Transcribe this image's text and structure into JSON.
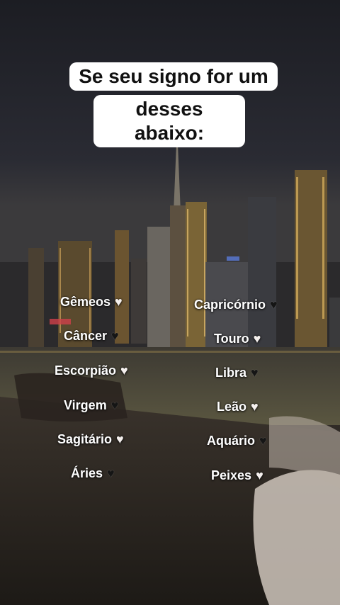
{
  "caption": {
    "line1": "Se seu signo for um",
    "line2": "desses abaixo:"
  },
  "left_signs": [
    {
      "name": "Gêmeos",
      "heart": "white-heart-icon",
      "glyph": "♥",
      "color": "white"
    },
    {
      "name": "Câncer",
      "heart": "black-heart-icon",
      "glyph": "♥",
      "color": "black"
    },
    {
      "name": "Escorpião",
      "heart": "white-heart-icon",
      "glyph": "♥",
      "color": "white"
    },
    {
      "name": "Virgem",
      "heart": "black-heart-icon",
      "glyph": "♥",
      "color": "black"
    },
    {
      "name": "Sagitário",
      "heart": "white-heart-icon",
      "glyph": "♥",
      "color": "white"
    },
    {
      "name": "Áries",
      "heart": "black-heart-icon",
      "glyph": "♥",
      "color": "black"
    }
  ],
  "right_signs": [
    {
      "name": "Capricórnio",
      "heart": "black-heart-icon",
      "glyph": "♥",
      "color": "black"
    },
    {
      "name": "Touro",
      "heart": "white-heart-icon",
      "glyph": "♥",
      "color": "white"
    },
    {
      "name": "Libra",
      "heart": "black-heart-icon",
      "glyph": "♥",
      "color": "black"
    },
    {
      "name": "Leão",
      "heart": "white-heart-icon",
      "glyph": "♥",
      "color": "white"
    },
    {
      "name": "Aquário",
      "heart": "black-heart-icon",
      "glyph": "♥",
      "color": "black"
    },
    {
      "name": "Peixes",
      "heart": "white-heart-icon",
      "glyph": "♥",
      "color": "white"
    }
  ]
}
